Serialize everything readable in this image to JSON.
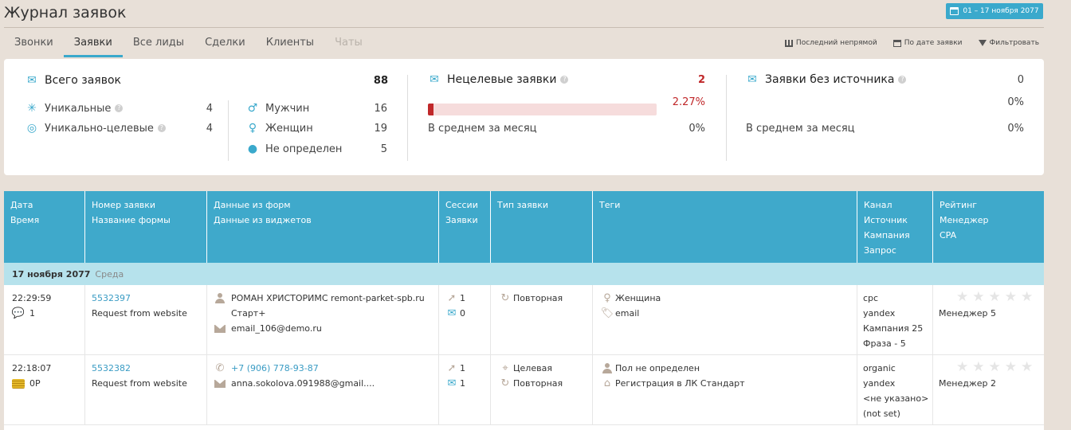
{
  "header": {
    "title": "Журнал заявок",
    "date_range": "01 – 17 ноября 2077"
  },
  "tabs": [
    {
      "label": "Звонки",
      "active": false,
      "disabled": false
    },
    {
      "label": "Заявки",
      "active": true,
      "disabled": false
    },
    {
      "label": "Все лиды",
      "active": false,
      "disabled": false
    },
    {
      "label": "Сделки",
      "active": false,
      "disabled": false
    },
    {
      "label": "Клиенты",
      "active": false,
      "disabled": false
    },
    {
      "label": "Чаты",
      "active": false,
      "disabled": true
    }
  ],
  "toolbar": {
    "last_indirect": "Последний непрямой",
    "by_date": "По дате заявки",
    "filter": "Фильтровать"
  },
  "stats": {
    "total": {
      "label": "Всего заявок",
      "value": "88"
    },
    "unique": {
      "label": "Уникальные",
      "value": "4"
    },
    "unique_target": {
      "label": "Уникально-целевые",
      "value": "4"
    },
    "male": {
      "label": "Мужчин",
      "value": "16"
    },
    "female": {
      "label": "Женщин",
      "value": "19"
    },
    "undefined": {
      "label": "Не определен",
      "value": "5"
    },
    "nontarget": {
      "label": "Нецелевые заявки",
      "value": "2",
      "percent": "2.27%",
      "percent_value": 2.27,
      "avg_label": "В среднем за месяц",
      "avg_value": "0%"
    },
    "nosource": {
      "label": "Заявки без источника",
      "value": "0",
      "percent": "0%",
      "avg_label": "В среднем за месяц",
      "avg_value": "0%"
    }
  },
  "table": {
    "columns": [
      [
        "Дата",
        "Время"
      ],
      [
        "Номер заявки",
        "Название формы"
      ],
      [
        "Данные из форм",
        "Данные из виджетов"
      ],
      [
        "Сессии",
        "Заявки"
      ],
      [
        "Тип заявки"
      ],
      [
        "Теги"
      ],
      [
        "Канал",
        "Источник",
        "Кампания",
        "Запрос"
      ],
      [
        "Рейтинг",
        "Менеджер",
        "CPA"
      ]
    ],
    "day": {
      "date": "17 ноября 2077",
      "weekday": "Среда"
    },
    "rows": [
      {
        "time": "22:29:59",
        "sub": "1",
        "number": "5532397",
        "form": "Request from website",
        "name": "РОМАН ХРИСТОРИМС remont-parket-spb.ru",
        "name2": "Старт+",
        "email": "email_106@demo.ru",
        "sessions": "1",
        "requests": "0",
        "type1": "Повторная",
        "tag1": "Женщина",
        "tag2": "email",
        "channel": "cpc",
        "source": "yandex",
        "campaign": "Кампания 25",
        "query": "Фраза - 5",
        "manager": "Менеджер 5",
        "rating": 0
      },
      {
        "time": "22:18:07",
        "sub": "0Р",
        "number": "5532382",
        "form": "Request from website",
        "phone": "+7 (906) 778-93-87",
        "email": "anna.sokolova.091988@gmail....",
        "sessions": "1",
        "requests": "1",
        "type1": "Целевая",
        "type2": "Повторная",
        "tag1": "Пол не определен",
        "tag2": "Регистрация в ЛК Стандарт",
        "channel": "organic",
        "source": "yandex",
        "campaign": "<не указано>",
        "query": "(not set)",
        "manager": "Менеджер 2",
        "rating": 0
      }
    ]
  }
}
